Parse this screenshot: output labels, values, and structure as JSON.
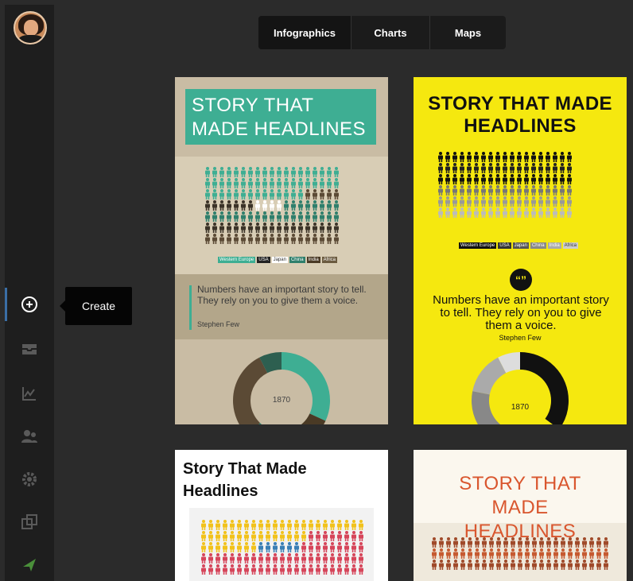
{
  "tabs": [
    {
      "label": "Infographics",
      "active": true
    },
    {
      "label": "Charts",
      "active": false
    },
    {
      "label": "Maps",
      "active": false
    }
  ],
  "tooltip": "Create",
  "sidebar": {
    "items": [
      {
        "icon": "create-icon",
        "active": true
      },
      {
        "icon": "inbox-icon",
        "active": false
      },
      {
        "icon": "chart-icon",
        "active": false
      },
      {
        "icon": "users-icon",
        "active": false
      },
      {
        "icon": "gear-icon",
        "active": false
      },
      {
        "icon": "copy-icon",
        "active": false
      },
      {
        "icon": "rocket-icon",
        "active": false
      }
    ]
  },
  "templates": [
    {
      "title": "STORY THAT MADE HEADLINES",
      "legend": [
        "Western Europe",
        "USA",
        "Japan",
        "China",
        "India",
        "Africa"
      ],
      "quote": "Numbers have an important story to tell. They rely on you to give them a voice.",
      "author": "Stephen Few",
      "donut_label": "1870",
      "accent": "#3eae93"
    },
    {
      "title": "STORY THAT MADE HEADLINES",
      "legend": [
        "Western Europe",
        "USA",
        "Japan",
        "China",
        "India",
        "Africa"
      ],
      "quote": "Numbers have an important story to tell. They rely on you to give them a voice.",
      "author": "Stephen Few",
      "donut_label": "1870",
      "accent": "#f5e80f"
    },
    {
      "title": "Story That Made Headlines",
      "accent": "#ffffff"
    },
    {
      "title": "STORY THAT MADE HEADLINES",
      "accent": "#d9562e"
    }
  ]
}
